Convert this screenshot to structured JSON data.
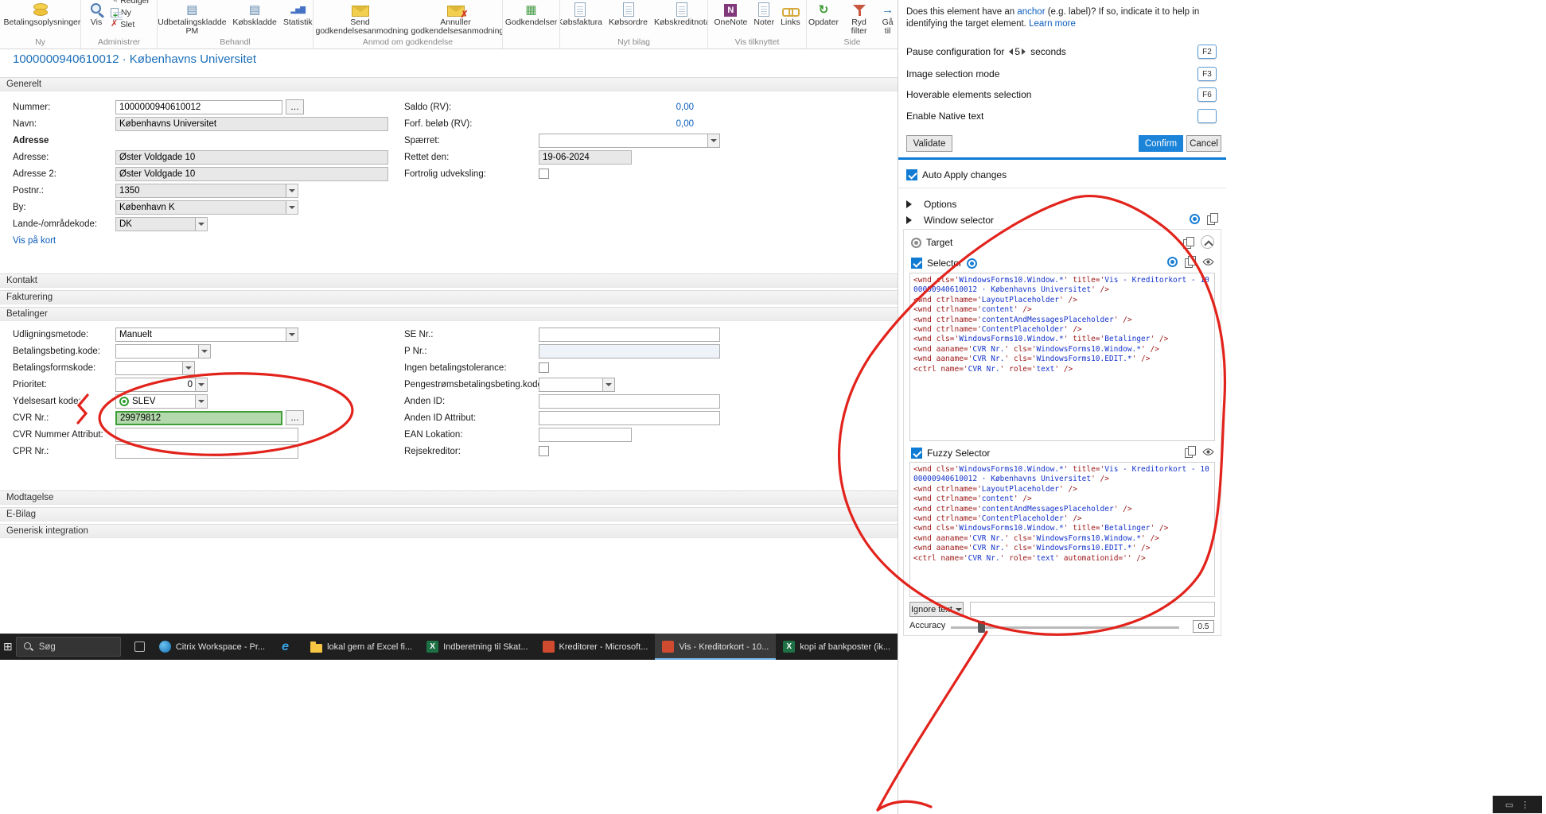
{
  "icons": {
    "refresh": "↻",
    "goto_arrow": "→",
    "delete_x": "✗",
    "edit_pencil": "✎",
    "journal": "▤",
    "approvals_grid": "▦",
    "chart_bars": "▂▅▇",
    "onenote_letter": "N",
    "edge_letter": "e",
    "excel_letter": "X",
    "ellipsis": "…",
    "start": "⊞",
    "tray_window": "▭",
    "tray_dots": "⋮"
  },
  "ribbon": {
    "groups": [
      {
        "label": "Ny",
        "items": [
          {
            "label": "Betalingsoplysninger"
          }
        ]
      },
      {
        "label": "Administrer",
        "items": [
          {
            "label": "Vis"
          },
          {
            "label": "Rediger"
          },
          {
            "label": "Ny"
          },
          {
            "label": "Slet"
          }
        ]
      },
      {
        "label": "Behandl",
        "items": [
          {
            "label": "Udbetalingskladde PM"
          },
          {
            "label": "Købskladde"
          },
          {
            "label": "Statistik"
          }
        ]
      },
      {
        "label": "Anmod om godkendelse",
        "items": [
          {
            "label": "Send godkendelsesanmodning"
          },
          {
            "label": "Annuller godkendelsesanmodning"
          }
        ]
      },
      {
        "label": "",
        "items": [
          {
            "label": "Godkendelser"
          }
        ]
      },
      {
        "label": "Nyt bilag",
        "items": [
          {
            "label": "Købsfaktura"
          },
          {
            "label": "Købsordre"
          },
          {
            "label": "Købskreditnota"
          }
        ]
      },
      {
        "label": "Vis tilknyttet",
        "items": [
          {
            "label": "OneNote"
          },
          {
            "label": "Noter"
          },
          {
            "label": "Links"
          }
        ]
      },
      {
        "label": "Side",
        "items": [
          {
            "label": "Opdater"
          },
          {
            "label": "Ryd filter"
          },
          {
            "label": "Gå til"
          }
        ]
      }
    ]
  },
  "page": {
    "title": "1000000940610012 · Københavns Universitet"
  },
  "sections": {
    "generelt": "Generelt",
    "kontakt": "Kontakt",
    "fakturering": "Fakturering",
    "betalinger": "Betalinger",
    "modtagelse": "Modtagelse",
    "ebilag": "E-Bilag",
    "generisk": "Generisk integration"
  },
  "generelt": {
    "left": {
      "nummer_label": "Nummer:",
      "nummer": "1000000940610012",
      "navn_label": "Navn:",
      "navn": "Københavns Universitet",
      "adresse_heading": "Adresse",
      "adresse_label": "Adresse:",
      "adresse": "Øster Voldgade 10",
      "adresse2_label": "Adresse 2:",
      "adresse2": "Øster Voldgade 10",
      "postnr_label": "Postnr.:",
      "postnr": "1350",
      "by_label": "By:",
      "by": "København K",
      "lande_label": "Lande-/områdekode:",
      "lande": "DK",
      "vis_pa_kort": "Vis på kort"
    },
    "right": {
      "saldo_label": "Saldo (RV):",
      "saldo": "0,00",
      "forf_label": "Forf. beløb (RV):",
      "forf": "0,00",
      "spaerret_label": "Spærret:",
      "spaerret": "",
      "rettet_label": "Rettet den:",
      "rettet": "19-06-2024",
      "fortrolig_label": "Fortrolig udveksling:"
    }
  },
  "betalinger": {
    "left": {
      "udligning_label": "Udligningsmetode:",
      "udligning": "Manuelt",
      "betbeting_label": "Betalingsbeting.kode:",
      "betbeting": "",
      "betform_label": "Betalingsformskode:",
      "betform": "",
      "prioritet_label": "Prioritet:",
      "prioritet": "0",
      "ydelsesart_label": "Ydelsesart kode:",
      "ydelsesart": "SLEV",
      "cvr_label": "CVR Nr.:",
      "cvr": "29979812",
      "cvrattr_label": "CVR Nummer Attribut:",
      "cvrattr": "",
      "cpr_label": "CPR Nr.:",
      "cpr": ""
    },
    "right": {
      "se_label": "SE Nr.:",
      "se": "",
      "p_label": "P Nr.:",
      "p": "",
      "tolerance_label": "Ingen betalingstolerance:",
      "penge_label": "Pengestrømsbetalingsbeting.kode:",
      "penge": "",
      "andenid_label": "Anden ID:",
      "andenid": "",
      "andenidattr_label": "Anden ID Attribut:",
      "andenidattr": "",
      "ean_label": "EAN Lokation:",
      "ean": "",
      "rejse_label": "Rejsekreditor:"
    }
  },
  "inspector": {
    "hint": {
      "text_before": "Does this element have an ",
      "anchor_word": "anchor",
      "text_after": " (e.g. label)? If so, indicate it to help in identifying the target element. ",
      "learn_more": "Learn more"
    },
    "rows": [
      {
        "label": "Pause configuration for",
        "value": "5",
        "suffix": "seconds",
        "key": "F2"
      },
      {
        "label": "Image selection mode",
        "key": "F3"
      },
      {
        "label": "Hoverable elements selection",
        "key": "F6"
      },
      {
        "label": "Enable Native text",
        "key": ""
      }
    ],
    "validate": "Validate",
    "confirm": "Confirm",
    "cancel": "Cancel",
    "auto_apply": "Auto Apply changes",
    "options": "Options",
    "window_selector": "Window selector",
    "target": "Target",
    "selector_title": "Selector",
    "fuzzy_title": "Fuzzy Selector",
    "selector_lines": [
      "<wnd cls='WindowsForms10.Window.*' title='Vis - Kreditorkort - 1000000940610012 · Københavns Universitet' />",
      "<wnd ctrlname='LayoutPlaceholder' />",
      "<wnd ctrlname='content' />",
      "<wnd ctrlname='contentAndMessagesPlaceholder' />",
      "<wnd ctrlname='ContentPlaceholder' />",
      "<wnd cls='WindowsForms10.Window.*' title='Betalinger' />",
      "<wnd aaname='CVR Nr.' cls='WindowsForms10.Window.*' />",
      "<wnd aaname='CVR Nr.' cls='WindowsForms10.EDIT.*' />",
      "<ctrl name='CVR Nr.' role='text' />"
    ],
    "fuzzy_lines": [
      "<wnd cls='WindowsForms10.Window.*' title='Vis - Kreditorkort - 1000000940610012 · Københavns Universitet' />",
      "<wnd ctrlname='LayoutPlaceholder' />",
      "<wnd ctrlname='content' />",
      "<wnd ctrlname='contentAndMessagesPlaceholder' />",
      "<wnd ctrlname='ContentPlaceholder' />",
      "<wnd cls='WindowsForms10.Window.*' title='Betalinger' />",
      "<wnd aaname='CVR Nr.' cls='WindowsForms10.Window.*' />",
      "<wnd aaname='CVR Nr.' cls='WindowsForms10.EDIT.*' />",
      "<ctrl name='CVR Nr.' role='text' automationid='' />"
    ],
    "ignore_text": "Ignore text",
    "accuracy_label": "Accuracy",
    "accuracy_value": "0.5"
  },
  "taskbar": {
    "search_placeholder": "Søg",
    "items": [
      {
        "label": "Citrix Workspace - Pr..."
      },
      {
        "label": ""
      },
      {
        "label": "lokal gem af Excel fi..."
      },
      {
        "label": "Indberetning til Skat..."
      },
      {
        "label": "Kreditorer - Microsoft..."
      },
      {
        "label": "Vis - Kreditorkort - 10..."
      },
      {
        "label": "kopi af bankposter (ik..."
      }
    ]
  }
}
